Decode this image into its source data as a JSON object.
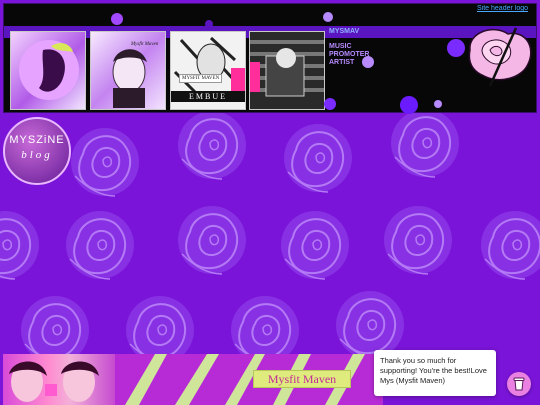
{
  "header": {
    "broken_image_alt": "Site header logo",
    "handle": "MYSMAV",
    "roles": [
      "MUSIC",
      "PROMOTER",
      "ARTIST"
    ]
  },
  "thumbnails": [
    {
      "name": "portrait-1"
    },
    {
      "name": "portrait-2",
      "caption": "Mysfit Maven"
    },
    {
      "name": "portrait-3",
      "label": "MYSFIT MAVEN",
      "caption": "EMBUE"
    },
    {
      "name": "portrait-4"
    }
  ],
  "blog_badge": {
    "line1": "MYSZiNE",
    "line2": "blog"
  },
  "footer": {
    "banner_title": "Mysfit Maven"
  },
  "chat": {
    "message": "Thank you so much for supporting! You're the best!Love Mys (Mysfit Maven)"
  },
  "colors": {
    "page_bg": "#7a14d8",
    "header_bg": "#070707",
    "accent_pink": "#e980e2",
    "rose_outline": "#a55ff0"
  },
  "icons": {
    "cup": "coffee-cup-icon",
    "rose": "pink-rose-logo-icon"
  }
}
